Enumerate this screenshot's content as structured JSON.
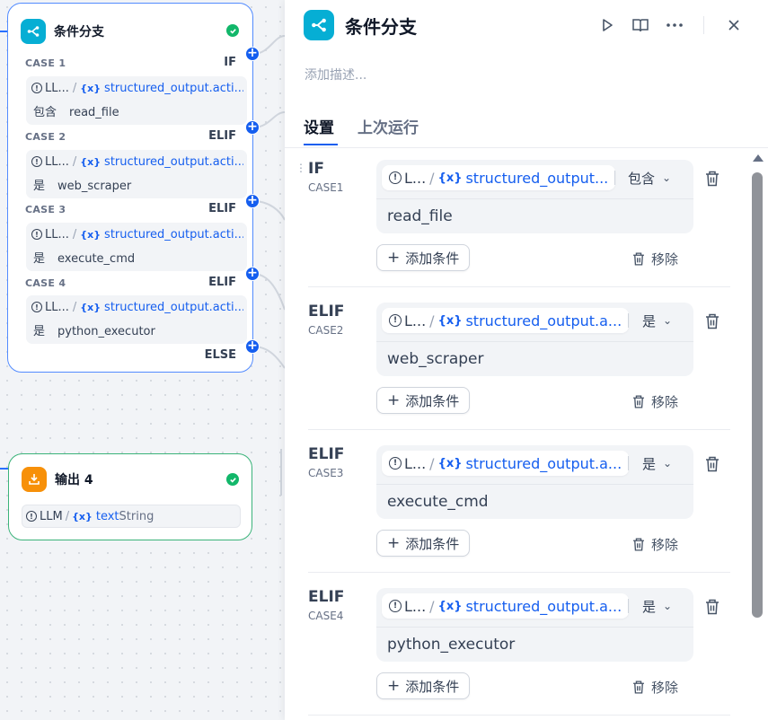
{
  "canvas": {
    "ifelse_node": {
      "title": "条件分支",
      "cases": [
        {
          "label": "CASE 1",
          "keyword": "IF",
          "var_source": "LL...",
          "var_name": "structured_output.acti...",
          "operator": "包含",
          "value": "read_file"
        },
        {
          "label": "CASE 2",
          "keyword": "ELIF",
          "var_source": "LL...",
          "var_name": "structured_output.acti...",
          "operator": "是",
          "value": "web_scraper"
        },
        {
          "label": "CASE 3",
          "keyword": "ELIF",
          "var_source": "LL...",
          "var_name": "structured_output.acti...",
          "operator": "是",
          "value": "execute_cmd"
        },
        {
          "label": "CASE 4",
          "keyword": "ELIF",
          "var_source": "LL...",
          "var_name": "structured_output.acti...",
          "operator": "是",
          "value": "python_executor"
        }
      ],
      "else_label": "ELSE"
    },
    "output_node": {
      "title": "输出 4",
      "var_source": "LLM",
      "var_name": "text",
      "var_type": "String"
    }
  },
  "panel": {
    "title": "条件分支",
    "description_placeholder": "添加描述...",
    "tabs": [
      "设置",
      "上次运行"
    ],
    "add_condition_label": "添加条件",
    "remove_label": "移除",
    "cases": [
      {
        "keyword": "IF",
        "case_name": "CASE1",
        "var_source": "L...",
        "var_name": "structured_output...",
        "operator": "包含",
        "value": "read_file"
      },
      {
        "keyword": "ELIF",
        "case_name": "CASE2",
        "var_source": "L...",
        "var_name": "structured_output.a...",
        "operator": "是",
        "value": "web_scraper"
      },
      {
        "keyword": "ELIF",
        "case_name": "CASE3",
        "var_source": "L...",
        "var_name": "structured_output.a...",
        "operator": "是",
        "value": "execute_cmd"
      },
      {
        "keyword": "ELIF",
        "case_name": "CASE4",
        "var_source": "L...",
        "var_name": "structured_output.a...",
        "operator": "是",
        "value": "python_executor"
      }
    ]
  },
  "colors": {
    "accent_blue": "#155eef",
    "node_icon_cyan": "#06aed4",
    "output_icon_orange": "#f79009",
    "success_green": "#12b76a"
  }
}
